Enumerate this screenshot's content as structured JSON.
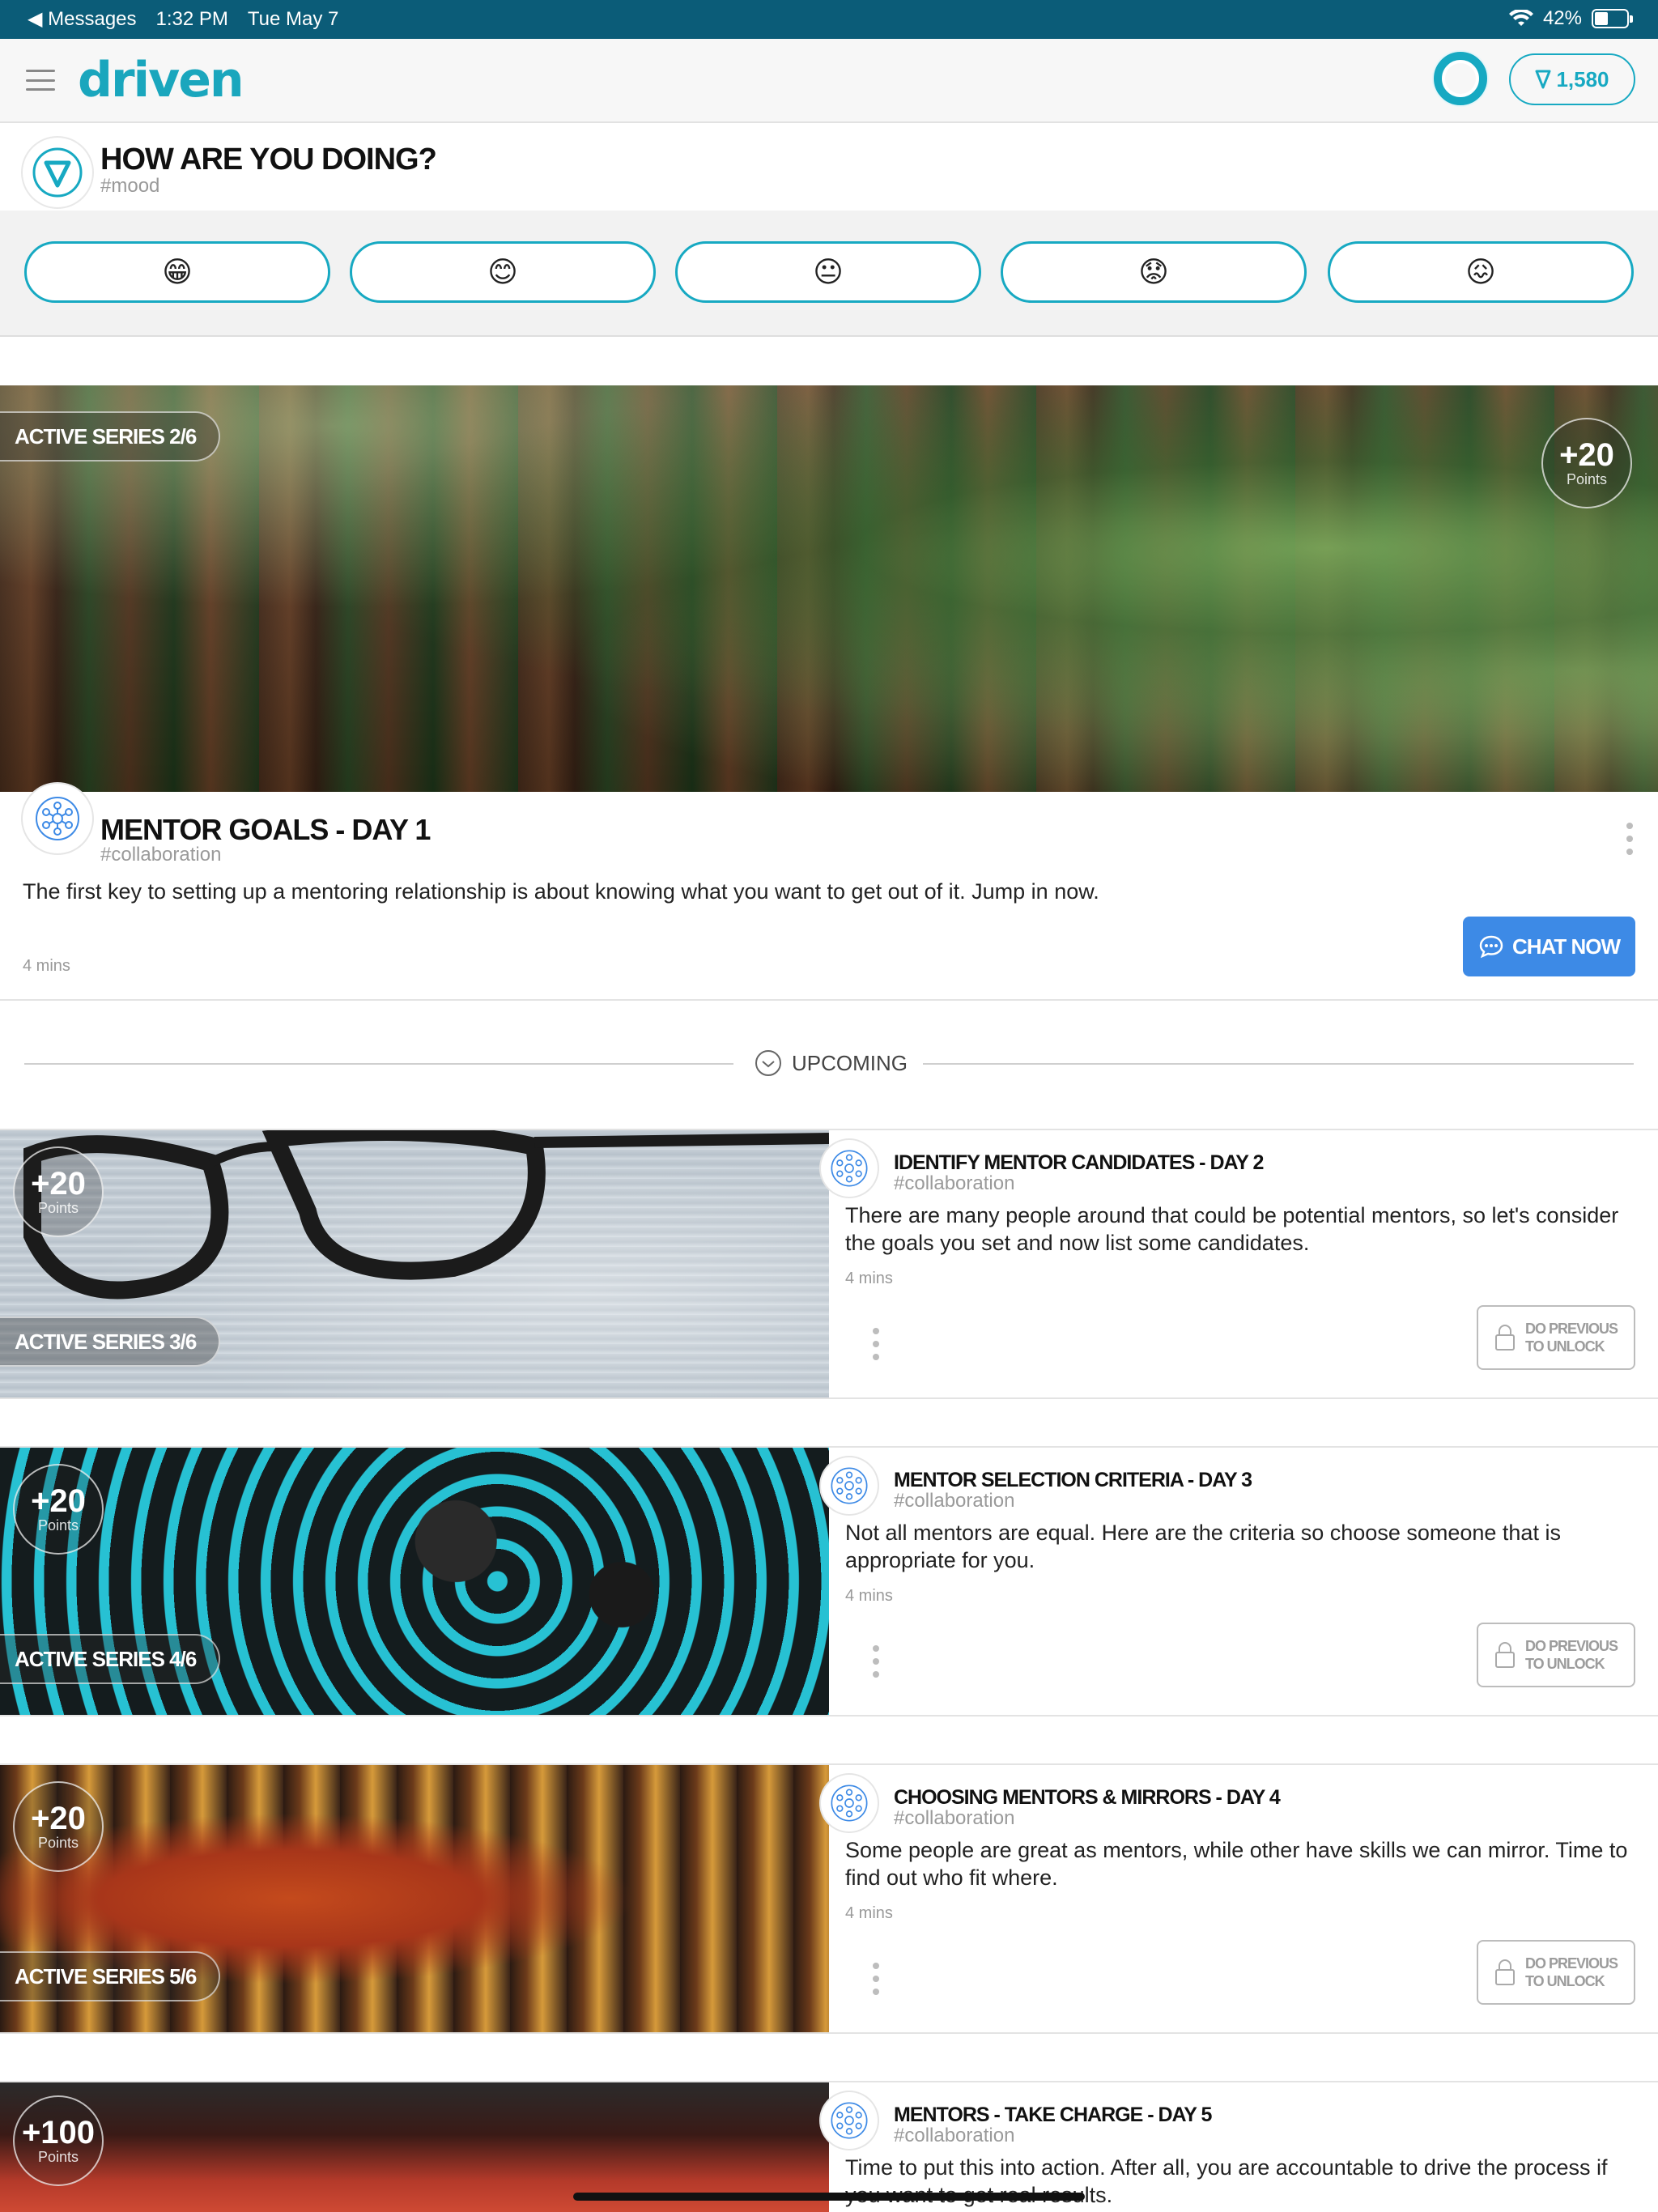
{
  "status_bar": {
    "back_label": "◀ Messages",
    "time": "1:32 PM",
    "date": "Tue May 7",
    "battery": "42%",
    "battery_level": 0.42
  },
  "nav": {
    "logo": "driven",
    "points": "1,580"
  },
  "mood": {
    "title": "HOW ARE YOU DOING?",
    "tag": "#mood",
    "options": [
      "😁",
      "😊",
      "😐",
      "😟",
      "😖"
    ]
  },
  "hero": {
    "series": "ACTIVE SERIES 2/6",
    "points": "+20",
    "points_label": "Points",
    "title": "MENTOR GOALS - DAY 1",
    "tag": "#collaboration",
    "description": "The first key to setting up a mentoring relationship is about knowing what you want to get out of it. Jump in now.",
    "mins": "4 mins",
    "cta": "CHAT NOW"
  },
  "upcoming": {
    "label": "UPCOMING",
    "lock_line1": "DO PREVIOUS",
    "lock_line2": "TO UNLOCK",
    "cards": [
      {
        "series": "ACTIVE SERIES 3/6",
        "points": "+20",
        "points_label": "Points",
        "title": "IDENTIFY MENTOR CANDIDATES - DAY 2",
        "tag": "#collaboration",
        "description": "There are many people around that could be potential mentors, so let's consider the goals you set and now list some candidates.",
        "mins": "4 mins"
      },
      {
        "series": "ACTIVE SERIES 4/6",
        "points": "+20",
        "points_label": "Points",
        "title": "MENTOR SELECTION CRITERIA - DAY 3",
        "tag": "#collaboration",
        "description": "Not all mentors are equal. Here are the criteria so choose someone that is appropriate for you.",
        "mins": "4 mins"
      },
      {
        "series": "ACTIVE SERIES 5/6",
        "points": "+20",
        "points_label": "Points",
        "title": "CHOOSING MENTORS & MIRRORS - DAY 4",
        "tag": "#collaboration",
        "description": "Some people are great as mentors, while other have skills we can mirror. Time to find out who fit where.",
        "mins": "4 mins"
      },
      {
        "series": "",
        "points": "+100",
        "points_label": "Points",
        "title": "MENTORS - TAKE CHARGE - DAY 5",
        "tag": "#collaboration",
        "description": "Time to put this into action. After all, you are accountable to drive the process if you want to get real results.",
        "mins": ""
      }
    ]
  },
  "colors": {
    "brand": "#17a9c2",
    "status_bar": "#0b5c78",
    "cta": "#3d8ae6"
  }
}
